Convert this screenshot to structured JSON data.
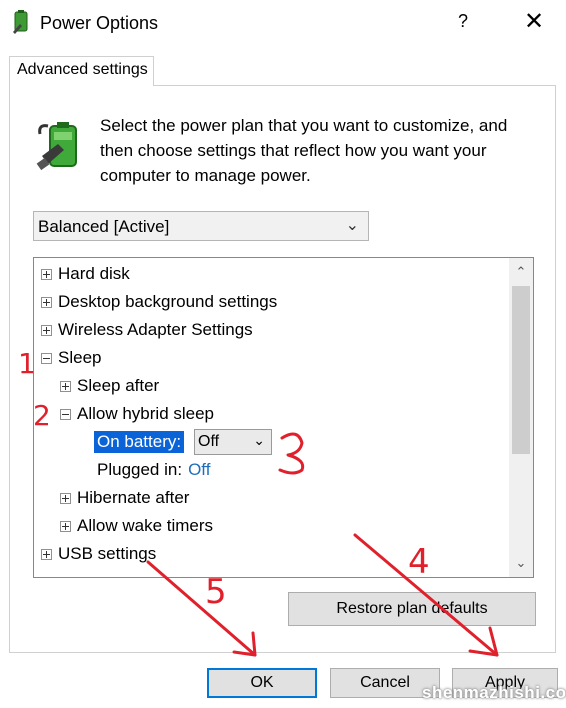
{
  "window": {
    "title": "Power Options",
    "help": "?",
    "close": "✕"
  },
  "tab": {
    "label": "Advanced settings"
  },
  "intro": "Select the power plan that you want to customize, and then choose settings that reflect how you want your computer to manage power.",
  "plan_select": {
    "value": "Balanced [Active]"
  },
  "tree": {
    "items": [
      {
        "label": "Hard disk"
      },
      {
        "label": "Desktop background settings"
      },
      {
        "label": "Wireless Adapter Settings"
      },
      {
        "label": "Sleep"
      },
      {
        "label": "Sleep after"
      },
      {
        "label": "Allow hybrid sleep"
      },
      {
        "label": "On battery:",
        "value": "Off"
      },
      {
        "label": "Plugged in:",
        "value": "Off"
      },
      {
        "label": "Hibernate after"
      },
      {
        "label": "Allow wake timers"
      },
      {
        "label": "USB settings"
      }
    ]
  },
  "buttons": {
    "restore": "Restore plan defaults",
    "ok": "OK",
    "cancel": "Cancel",
    "apply": "Apply"
  },
  "annotations": [
    "1",
    "2",
    "3",
    "4",
    "5"
  ],
  "watermark": "shenmazhishi.com",
  "colors": {
    "accent": "#0078d7",
    "selection": "#0a64d8",
    "annotation": "#e0202a"
  }
}
